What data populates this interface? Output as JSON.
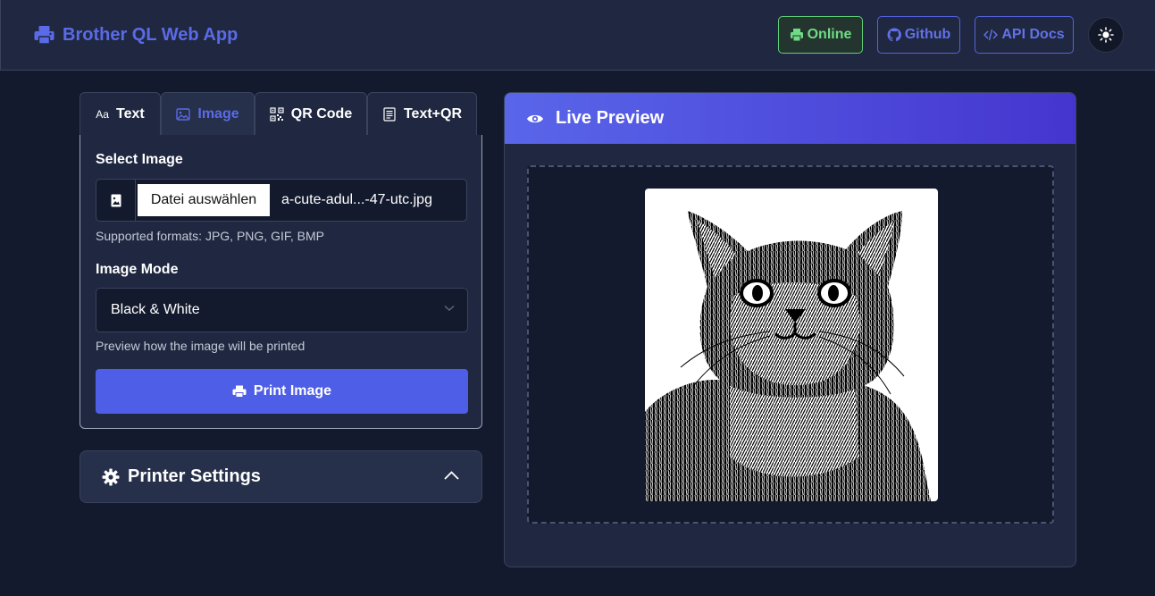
{
  "header": {
    "brand": "Brother QL Web App",
    "online_label": "Online",
    "github_label": "Github",
    "api_docs_label": "API Docs"
  },
  "tabs": [
    {
      "label": "Text",
      "icon": "text-aa-icon"
    },
    {
      "label": "Image",
      "icon": "image-icon",
      "active": true
    },
    {
      "label": "QR Code",
      "icon": "qr-icon"
    },
    {
      "label": "Text+QR",
      "icon": "document-icon"
    }
  ],
  "image_panel": {
    "select_label": "Select Image",
    "file_button": "Datei auswählen",
    "file_name": "a-cute-adul...-47-utc.jpg",
    "formats_hint": "Supported formats: JPG, PNG, GIF, BMP",
    "mode_label": "Image Mode",
    "mode_value": "Black & White",
    "mode_hint": "Preview how the image will be printed",
    "print_button": "Print Image"
  },
  "settings": {
    "title": "Printer Settings"
  },
  "preview": {
    "title": "Live Preview"
  },
  "colors": {
    "accent": "#4f5ee6",
    "online": "#6fdb86",
    "background": "#131a2e",
    "panel": "#1f2840"
  }
}
